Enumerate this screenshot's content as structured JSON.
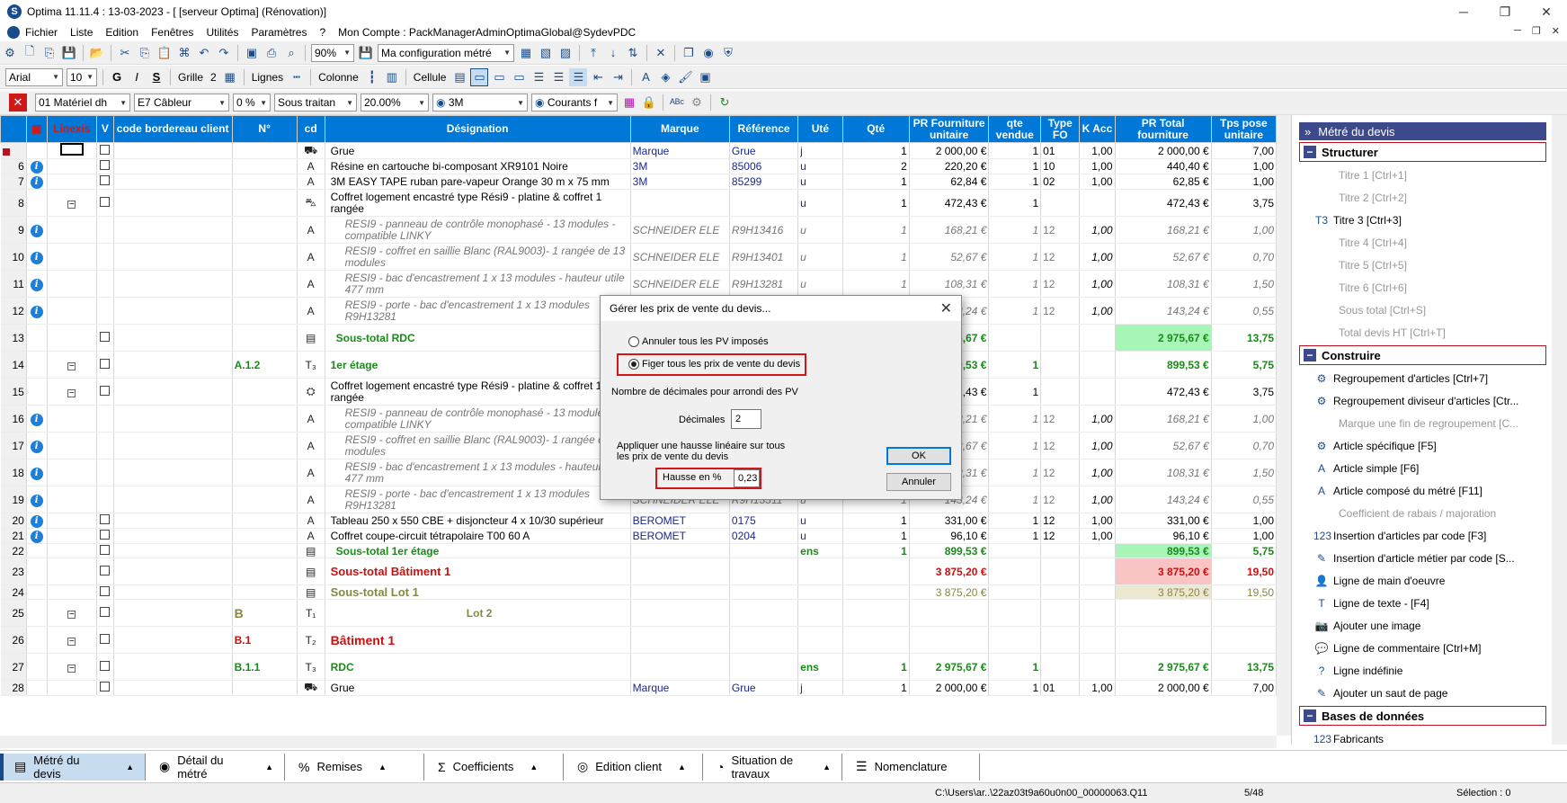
{
  "window": {
    "title": "Optima 11.11.4 : 13-03-2023 - [ [serveur Optima] (Rénovation)]"
  },
  "menu": {
    "items": [
      "Fichier",
      "Liste",
      "Edition",
      "Fenêtres",
      "Utilités",
      "Paramètres",
      "?"
    ],
    "account": "Mon Compte : PackManagerAdminOptimaGlobal@SydevPDC"
  },
  "toolbar1": {
    "zoom": "90%",
    "config": "Ma configuration métré"
  },
  "toolbar2": {
    "font": "Arial",
    "size": "10",
    "grille": "Grille",
    "grille_val": "2",
    "lignes": "Lignes",
    "colonne": "Colonne",
    "cellule": "Cellule"
  },
  "toolbar3": {
    "materiel": "01  Matériel dh",
    "cableur": "E7  Câbleur",
    "pct": "0 %",
    "soustraitant": "Sous traitan",
    "rate": "20.00%",
    "brand": "3M",
    "courants": "Courants f"
  },
  "grid": {
    "headers": [
      "",
      "",
      "Linexis",
      "V",
      "code bordereau client",
      "N°",
      "cd",
      "Désignation",
      "Marque",
      "Référence",
      "Uté",
      "Qté",
      "PR Fourniture unitaire",
      "qte vendue",
      "Type FO",
      "K Acc",
      "PR Total fourniture",
      "Tps pose unitaire"
    ],
    "rows": [
      {
        "n": "",
        "des": "Grue",
        "marque": "Marque",
        "ref": "Grue",
        "ute": "j",
        "qte": "1",
        "pr": "2 000,00 €",
        "qv": "1",
        "type": "01",
        "k": "1,00",
        "tot": "2 000,00 €",
        "tps": "7,00",
        "style": "",
        "cb": true,
        "info": false,
        "marker": true
      },
      {
        "n": "6",
        "des": "Résine en cartouche bi-composant XR9101 Noire",
        "marque": "3M",
        "ref": "85006",
        "ute": "u",
        "qte": "2",
        "pr": "220,20 €",
        "qv": "1",
        "type": "10",
        "k": "1,00",
        "tot": "440,40 €",
        "tps": "1,00",
        "style": "",
        "cb": true,
        "info": true
      },
      {
        "n": "7",
        "des": "3M EASY TAPE ruban pare-vapeur Orange 30 m x 75 mm",
        "marque": "3M",
        "ref": "85299",
        "ute": "u",
        "qte": "1",
        "pr": "62,84 €",
        "qv": "1",
        "type": "02",
        "k": "1,00",
        "tot": "62,85 €",
        "tps": "1,00",
        "style": "",
        "cb": true,
        "info": true
      },
      {
        "n": "8",
        "des": "Coffret logement encastré type Rési9 - platine & coffret 1 rangée",
        "marque": "",
        "ref": "",
        "ute": "u",
        "qte": "1",
        "pr": "472,43 €",
        "qv": "1",
        "type": "",
        "k": "",
        "tot": "472,43 €",
        "tps": "3,75",
        "style": "",
        "cb": true,
        "info": false,
        "tree": true,
        "tall": true
      },
      {
        "n": "9",
        "des": "RESI9 - panneau de contrôle monophasé - 13 modules - compatible LINKY",
        "marque": "SCHNEIDER ELE",
        "ref": "R9H13416",
        "ute": "u",
        "qte": "1",
        "pr": "168,21 €",
        "qv": "1",
        "type": "12",
        "k": "1,00",
        "tot": "168,21 €",
        "tps": "1,00",
        "style": "ital",
        "cb": false,
        "info": true,
        "tall": true
      },
      {
        "n": "10",
        "des": "RESI9 - coffret en saillie Blanc (RAL9003)- 1 rangée de 13 modules",
        "marque": "SCHNEIDER ELE",
        "ref": "R9H13401",
        "ute": "u",
        "qte": "1",
        "pr": "52,67 €",
        "qv": "1",
        "type": "12",
        "k": "1,00",
        "tot": "52,67 €",
        "tps": "0,70",
        "style": "ital",
        "cb": false,
        "info": true,
        "tall": true
      },
      {
        "n": "11",
        "des": "RESI9 - bac d'encastrement 1 x 13 modules - hauteur utile 477 mm",
        "marque": "SCHNEIDER ELE",
        "ref": "R9H13281",
        "ute": "u",
        "qte": "1",
        "pr": "108,31 €",
        "qv": "1",
        "type": "12",
        "k": "1,00",
        "tot": "108,31 €",
        "tps": "1,50",
        "style": "ital",
        "cb": false,
        "info": true,
        "tall": true
      },
      {
        "n": "12",
        "des": "RESI9 - porte - bac d'encastrement 1 x 13 modules R9H13281",
        "marque": "SCHNEIDER ELE",
        "ref": "R9H13311",
        "ute": "u",
        "qte": "1",
        "pr": "143,24 €",
        "qv": "1",
        "type": "12",
        "k": "1,00",
        "tot": "143,24 €",
        "tps": "0,55",
        "style": "ital",
        "cb": false,
        "info": true,
        "tall": true
      },
      {
        "n": "13",
        "des": "Sous-total RDC",
        "marque": "",
        "ref": "",
        "ute": "",
        "qte": "",
        "pr": "2 975,67 €",
        "qv": "",
        "type": "",
        "k": "",
        "tot": "2 975,67 €",
        "tps": "13,75",
        "style": "green",
        "cb": true,
        "info": false,
        "bgtot": "bg-green",
        "tall": true
      },
      {
        "n": "14",
        "no": "A.1.2",
        "des": "1er étage",
        "marque": "",
        "ref": "",
        "ute": "",
        "qte": "",
        "pr": "899,53 €",
        "qv": "1",
        "type": "",
        "k": "",
        "tot": "899,53 €",
        "tps": "5,75",
        "style": "green",
        "cb": true,
        "info": false,
        "tree": true,
        "tall": true
      },
      {
        "n": "15",
        "des": "Coffret logement encastré type Rési9 - platine & coffret 1 rangée",
        "marque": "",
        "ref": "",
        "ute": "",
        "qte": "",
        "pr": "472,43 €",
        "qv": "1",
        "type": "",
        "k": "",
        "tot": "472,43 €",
        "tps": "3,75",
        "style": "",
        "cb": true,
        "info": false,
        "tree": true,
        "tall": true
      },
      {
        "n": "16",
        "des": "RESI9 - panneau de contrôle monophasé - 13 modules - compatible LINKY",
        "marque": "SCHNEIDER ELE",
        "ref": "R9H13416",
        "ute": "u",
        "qte": "1",
        "pr": "168,21 €",
        "qv": "1",
        "type": "12",
        "k": "1,00",
        "tot": "168,21 €",
        "tps": "1,00",
        "style": "ital",
        "cb": false,
        "info": true,
        "tall": true
      },
      {
        "n": "17",
        "des": "RESI9 - coffret en saillie Blanc (RAL9003)- 1 rangée de 13 modules",
        "marque": "SCHNEIDER ELE",
        "ref": "R9H13401",
        "ute": "u",
        "qte": "1",
        "pr": "52,67 €",
        "qv": "1",
        "type": "12",
        "k": "1,00",
        "tot": "52,67 €",
        "tps": "0,70",
        "style": "ital",
        "cb": false,
        "info": true,
        "tall": true
      },
      {
        "n": "18",
        "des": "RESI9 - bac d'encastrement 1 x 13 modules - hauteur utile 477 mm",
        "marque": "SCHNEIDER ELE",
        "ref": "R9H13281",
        "ute": "u",
        "qte": "1",
        "pr": "108,31 €",
        "qv": "1",
        "type": "12",
        "k": "1,00",
        "tot": "108,31 €",
        "tps": "1,50",
        "style": "ital",
        "cb": false,
        "info": true,
        "tall": true
      },
      {
        "n": "19",
        "des": "RESI9 - porte - bac d'encastrement 1 x 13 modules R9H13281",
        "marque": "SCHNEIDER ELE",
        "ref": "R9H13311",
        "ute": "u",
        "qte": "1",
        "pr": "143,24 €",
        "qv": "1",
        "type": "12",
        "k": "1,00",
        "tot": "143,24 €",
        "tps": "0,55",
        "style": "ital",
        "cb": false,
        "info": true,
        "tall": true
      },
      {
        "n": "20",
        "des": "Tableau 250 x 550 CBE + disjoncteur 4 x 10/30 supérieur",
        "marque": "BEROMET",
        "ref": "0175",
        "ute": "u",
        "qte": "1",
        "pr": "331,00 €",
        "qv": "1",
        "type": "12",
        "k": "1,00",
        "tot": "331,00 €",
        "tps": "1,00",
        "style": "",
        "cb": true,
        "info": true
      },
      {
        "n": "21",
        "des": "Coffret coupe-circuit tétrapolaire T00 60 A",
        "marque": "BEROMET",
        "ref": "0204",
        "ute": "u",
        "qte": "1",
        "pr": "96,10 €",
        "qv": "1",
        "type": "12",
        "k": "1,00",
        "tot": "96,10 €",
        "tps": "1,00",
        "style": "",
        "cb": true,
        "info": true
      },
      {
        "n": "22",
        "des": "Sous-total 1er étage",
        "marque": "",
        "ref": "",
        "ute": "ens",
        "qte": "1",
        "pr": "899,53 €",
        "qv": "",
        "type": "",
        "k": "",
        "tot": "899,53 €",
        "tps": "5,75",
        "style": "green",
        "cb": true,
        "info": false,
        "bgtot": "bg-green"
      },
      {
        "n": "23",
        "des": "Sous-total Bâtiment 1",
        "marque": "",
        "ref": "",
        "ute": "",
        "qte": "",
        "pr": "3 875,20 €",
        "qv": "",
        "type": "",
        "k": "",
        "tot": "3 875,20 €",
        "tps": "19,50",
        "style": "red",
        "cb": true,
        "info": false,
        "bgtot": "bg-pink",
        "tall": true
      },
      {
        "n": "24",
        "des": "Sous-total Lot 1",
        "marque": "",
        "ref": "",
        "ute": "",
        "qte": "",
        "pr": "3 875,20 €",
        "qv": "",
        "type": "",
        "k": "",
        "tot": "3 875,20 €",
        "tps": "19,50",
        "style": "olive",
        "cb": true,
        "info": false,
        "bgtot": "bg-beige"
      },
      {
        "n": "25",
        "no": "B",
        "des": "Lot 2",
        "marque": "",
        "ref": "",
        "ute": "",
        "qte": "",
        "pr": "",
        "qv": "",
        "type": "",
        "k": "",
        "tot": "",
        "tps": "",
        "style": "lot",
        "cb": true,
        "info": false,
        "tree": true,
        "tall": true
      },
      {
        "n": "26",
        "no": "B.1",
        "des": "Bâtiment 1",
        "marque": "",
        "ref": "",
        "ute": "",
        "qte": "",
        "pr": "",
        "qv": "",
        "type": "",
        "k": "",
        "tot": "",
        "tps": "",
        "style": "red",
        "cb": true,
        "info": false,
        "tree": true,
        "tall": true
      },
      {
        "n": "27",
        "no": "B.1.1",
        "des": "RDC",
        "marque": "",
        "ref": "",
        "ute": "ens",
        "qte": "1",
        "pr": "2 975,67 €",
        "qv": "1",
        "type": "",
        "k": "",
        "tot": "2 975,67 €",
        "tps": "13,75",
        "style": "green",
        "cb": true,
        "info": false,
        "tree": true,
        "tall": true
      },
      {
        "n": "28",
        "des": "Grue",
        "marque": "Marque",
        "ref": "Grue",
        "ute": "j",
        "qte": "1",
        "pr": "2 000,00 €",
        "qv": "1",
        "type": "01",
        "k": "1,00",
        "tot": "2 000,00 €",
        "tps": "7,00",
        "style": "",
        "cb": true,
        "info": false
      }
    ]
  },
  "panel": {
    "title": "Métré du devis",
    "sections": [
      {
        "name": "Structurer",
        "items": [
          {
            "label": "Titre 1 [Ctrl+1]",
            "dis": true,
            "icon": ""
          },
          {
            "label": "Titre 2 [Ctrl+2]",
            "dis": true,
            "icon": ""
          },
          {
            "label": "Titre 3 [Ctrl+3]",
            "dis": false,
            "icon": "T3"
          },
          {
            "label": "Titre 4 [Ctrl+4]",
            "dis": true,
            "icon": ""
          },
          {
            "label": "Titre 5 [Ctrl+5]",
            "dis": true,
            "icon": ""
          },
          {
            "label": "Titre 6 [Ctrl+6]",
            "dis": true,
            "icon": ""
          },
          {
            "label": "Sous total [Ctrl+S]",
            "dis": true,
            "icon": ""
          },
          {
            "label": "Total devis HT [Ctrl+T]",
            "dis": true,
            "icon": ""
          }
        ]
      },
      {
        "name": "Construire",
        "items": [
          {
            "label": "Regroupement d'articles  [Ctrl+7]",
            "dis": false,
            "icon": "⚙"
          },
          {
            "label": "Regroupement diviseur d'articles [Ctr...",
            "dis": false,
            "icon": "⚙"
          },
          {
            "label": "Marque une fin de regroupement  [C...",
            "dis": true,
            "icon": ""
          },
          {
            "label": "Article spécifique [F5]",
            "dis": false,
            "icon": "⚙"
          },
          {
            "label": "Article simple [F6]",
            "dis": false,
            "icon": "A"
          },
          {
            "label": "Article composé du métré [F11]",
            "dis": false,
            "icon": "A"
          },
          {
            "label": "Coefficient de rabais / majoration",
            "dis": true,
            "icon": ""
          },
          {
            "label": "Insertion d'articles par code [F3]",
            "dis": false,
            "icon": "123"
          },
          {
            "label": "Insertion d'article métier par code [S...",
            "dis": false,
            "icon": "✎"
          },
          {
            "label": "Ligne de main d'oeuvre",
            "dis": false,
            "icon": "👤"
          },
          {
            "label": "Ligne de texte - [F4]",
            "dis": false,
            "icon": "T"
          },
          {
            "label": "Ajouter une image",
            "dis": false,
            "icon": "📷"
          },
          {
            "label": "Ligne de commentaire [Ctrl+M]",
            "dis": false,
            "icon": "💬"
          },
          {
            "label": "Ligne indéfinie",
            "dis": false,
            "icon": "?"
          },
          {
            "label": "Ajouter un saut de page",
            "dis": false,
            "icon": "✎"
          }
        ]
      },
      {
        "name": "Bases de données",
        "items": [
          {
            "label": "Fabricants",
            "dis": false,
            "icon": "123"
          }
        ]
      }
    ]
  },
  "tabs": [
    {
      "label": "Métré du devis",
      "icon": "▤",
      "active": true
    },
    {
      "label": "Détail du métré",
      "icon": "◉",
      "active": false
    },
    {
      "label": "Remises",
      "icon": "%",
      "active": false
    },
    {
      "label": "Coefficients",
      "icon": "Σ",
      "active": false
    },
    {
      "label": "Edition client",
      "icon": "◎",
      "active": false
    },
    {
      "label": "Situation de travaux",
      "icon": "◔",
      "active": false
    },
    {
      "label": "Nomenclature",
      "icon": "☰",
      "active": false
    }
  ],
  "status": {
    "path": "C:\\Users\\ar..\\22az03t9a60u0n00_00000063.Q11",
    "pos": "5/48",
    "selection": "Sélection : 0"
  },
  "dialog": {
    "title": "Gérer les prix de vente du devis...",
    "radio1": "Annuler tous les PV imposés",
    "radio2": "Figer tous les prix de vente du devis",
    "decimals_label": "Nombre de décimales pour arrondi des PV",
    "decimales": "Décimales",
    "decimales_val": "2",
    "hausse_text": "Appliquer une hausse linéaire sur tous les prix de vente du devis",
    "hausse_label": "Hausse en %",
    "hausse_val": "0,23",
    "ok": "OK",
    "cancel": "Annuler"
  }
}
